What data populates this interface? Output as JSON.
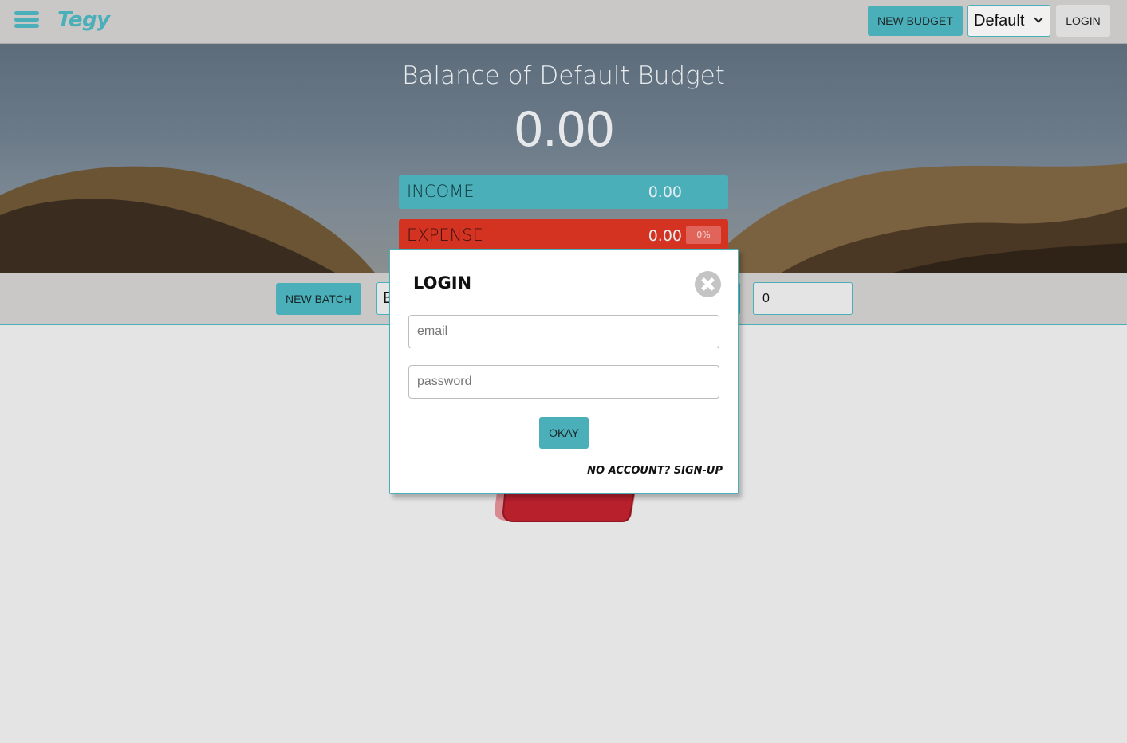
{
  "nav": {
    "brand": "Tegy",
    "new_budget_label": "NEW BUDGET",
    "budget_select_value": "Default",
    "login_label": "LOGIN"
  },
  "hero": {
    "title": "Balance of Default Budget",
    "balance": "0.00",
    "income": {
      "label": "INCOME",
      "amount": "0.00"
    },
    "expense": {
      "label": "EXPENSE",
      "amount": "0.00",
      "percent": "0%"
    }
  },
  "batch": {
    "new_batch_label": "NEW BATCH",
    "batch_input_value": "B",
    "amount_input_value": "0"
  },
  "login_dialog": {
    "title": "LOGIN",
    "email_placeholder": "email",
    "password_placeholder": "password",
    "okay_label": "OKAY",
    "signup_link": "NO ACCOUNT? SIGN-UP"
  },
  "colors": {
    "accent": "#4aafb8",
    "expense": "#d43322",
    "nav_background": "#c9c8c6",
    "page_background": "#e4e4e4"
  }
}
